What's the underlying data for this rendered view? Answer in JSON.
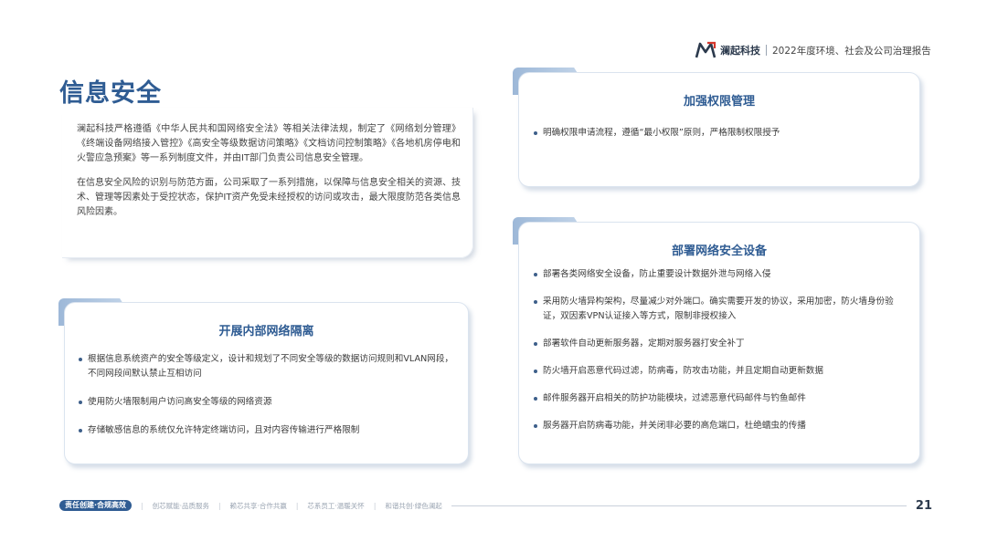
{
  "header": {
    "company": "澜起科技",
    "report_title": "2022年度环境、社会及公司治理报告"
  },
  "page_title": "信息安全",
  "intro": {
    "paragraphs": [
      "澜起科技严格遵循《中华人民共和国网络安全法》等相关法律法规，制定了《网络划分管理》《终端设备网络接入管控》《高安全等级数据访问策略》《文档访问控制策略》《各地机房停电和火警应急预案》等一系列制度文件，并由IT部门负责公司信息安全管理。",
      "在信息安全风险的识别与防范方面，公司采取了一系列措施，以保障与信息安全相关的资源、技术、管理等因素处于受控状态，保护IT资产免受未经授权的访问或攻击，最大限度防范各类信息风险因素。"
    ]
  },
  "cards": {
    "isolation": {
      "title": "开展内部网络隔离",
      "icon": "hacker-icon",
      "items": [
        "根据信息系统资产的安全等级定义，设计和规划了不同安全等级的数据访问规则和VLAN网段，不同网段间默认禁止互相访问",
        "使用防火墙限制用户访问高安全等级的网络资源",
        "存储敏感信息的系统仅允许特定终端访问，且对内容传输进行严格限制"
      ]
    },
    "permissions": {
      "title": "加强权限管理",
      "icon": "network-cube-icon",
      "items": [
        "明确权限申请流程，遵循“最小权限”原则，严格限制权限授予"
      ]
    },
    "devices": {
      "title": "部署网络安全设备",
      "icon": "laptop-security-icon",
      "items": [
        "部署各类网络安全设备，防止重要设计数据外泄与网络入侵",
        "采用防火墙异构架构，尽量减少对外端口。确实需要开发的协议，采用加密，防火墙身份验证，双因素VPN认证接入等方式，限制非授权接入",
        "部署软件自动更新服务器，定期对服务器打安全补丁",
        "防火墙开启恶意代码过滤，防病毒，防攻击功能，并且定期自动更新数据",
        "邮件服务器开启相关的防护功能模块，过滤恶意代码邮件与钓鱼邮件",
        "服务器开启防病毒功能，并关闭非必要的高危端口，杜绝蠕虫的传播"
      ]
    }
  },
  "footer": {
    "badge": "责任创建·合规高效",
    "items": [
      "创芯赋能·品质服务",
      "赖芯共享·合作共赢",
      "芯系员工·温暖关怀",
      "和谐共创·绿色澜起"
    ],
    "page_number": "21"
  },
  "colors": {
    "title_blue": "#2f5c93",
    "tab_gradient_start": "#9db8d8",
    "tab_gradient_end": "#c7d8eb",
    "logo_red": "#d6382e"
  }
}
